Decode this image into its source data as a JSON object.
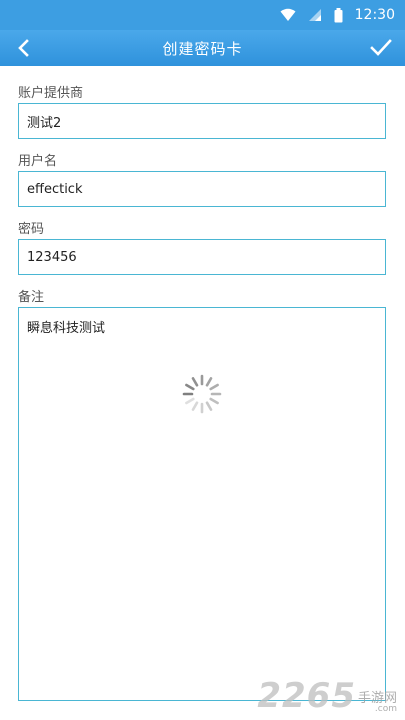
{
  "status_bar": {
    "time": "12:30",
    "icons": [
      "wifi-icon",
      "signal-icon",
      "battery-icon"
    ]
  },
  "app_bar": {
    "title": "创建密码卡",
    "back_icon": "chevron-left-icon",
    "confirm_icon": "checkmark-icon",
    "color": "#3d9ee2"
  },
  "form": {
    "provider_label": "账户提供商",
    "provider_value": "测试2",
    "username_label": "用户名",
    "username_value": "effectick",
    "password_label": "密码",
    "password_value": "123456",
    "notes_label": "备注",
    "notes_value": "瞬息科技测试",
    "border_color": "#4ab6d3"
  },
  "loading_icon": "spinner-icon",
  "watermark": {
    "number": "2265",
    "text": "手游网",
    "domain": ".com"
  }
}
